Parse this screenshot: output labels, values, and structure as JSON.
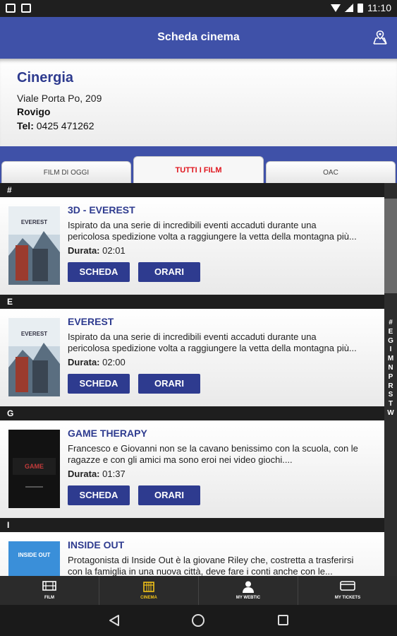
{
  "status": {
    "time": "11:10"
  },
  "appbar": {
    "title": "Scheda cinema"
  },
  "cinema": {
    "name": "Cinergia",
    "address": "Viale Porta Po, 209",
    "city": "Rovigo",
    "tel_label": "Tel:",
    "tel_value": "0425 471262"
  },
  "tabs": [
    {
      "label": "FILM DI OGGI"
    },
    {
      "label": "TUTTI I FILM"
    },
    {
      "label": "OAC"
    }
  ],
  "sections": [
    {
      "letter": "#",
      "movie": {
        "title": "3D - EVEREST",
        "desc1": "Ispirato da una serie di incredibili eventi accaduti durante una",
        "desc2": "pericolosa spedizione volta a raggiungere la vetta della montagna più...",
        "dur_label": "Durata:",
        "dur_value": "02:01",
        "poster_text": "EVEREST"
      }
    },
    {
      "letter": "E",
      "movie": {
        "title": "EVEREST",
        "desc1": "Ispirato da una serie di incredibili eventi accaduti durante una",
        "desc2": "pericolosa spedizione volta a raggiungere la vetta della montagna più...",
        "dur_label": "Durata:",
        "dur_value": "02:00",
        "poster_text": "EVEREST"
      }
    },
    {
      "letter": "G",
      "movie": {
        "title": "GAME THERAPY",
        "desc1": "Francesco e Giovanni non se la cavano benissimo con la scuola, con le",
        "desc2": "ragazze e con gli amici ma sono eroi nei video giochi....",
        "dur_label": "Durata:",
        "dur_value": "01:37",
        "poster_text": "GAME"
      }
    },
    {
      "letter": "I",
      "movie": {
        "title": "INSIDE OUT",
        "desc1": "Protagonista di Inside Out è la giovane Riley che, costretta a trasferirsi",
        "desc2": "con la famiglia in una nuova città, deve fare i conti anche con le...",
        "dur_label": "Durata:",
        "dur_value": "",
        "poster_text": "INSIDE OUT"
      }
    }
  ],
  "buttons": {
    "scheda": "SCHEDA",
    "orari": "ORARI"
  },
  "index_letters": [
    "#",
    "E",
    "G",
    "I",
    "M",
    "N",
    "P",
    "R",
    "S",
    "T",
    "W"
  ],
  "bottom_nav": [
    {
      "label": "FILM",
      "icon": "film-icon"
    },
    {
      "label": "CINEMA",
      "icon": "cinema-icon"
    },
    {
      "label": "MY WEBTIC",
      "icon": "user-icon"
    },
    {
      "label": "MY TICKETS",
      "icon": "ticket-icon"
    }
  ],
  "colors": {
    "primary": "#3f51a8",
    "title": "#2e3b8f",
    "button": "#2e3b8f",
    "active_tab": "#e0161e",
    "active_nav": "#f2c318"
  }
}
